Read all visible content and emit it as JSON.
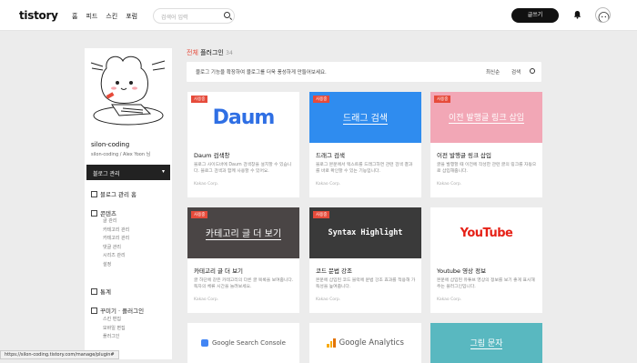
{
  "topbar": {
    "logo": "tistory",
    "nav": [
      "홈",
      "피드",
      "스킨",
      "포럼"
    ],
    "search_placeholder": "검색어 입력",
    "write_label": "글쓰기"
  },
  "sidebar": {
    "blog_name": "silon-coding",
    "blog_id": "silon-coding / Alex Yoon 님",
    "manage_label": "블로그 관리",
    "home_label": "블로그 관리 홈",
    "sections": [
      {
        "title": "콘텐츠",
        "items": [
          "글 관리",
          "카테고리 관리",
          "카테고리 관리",
          "댓글 관리",
          "시리즈 관리",
          "설정"
        ]
      },
      {
        "title": "통계"
      },
      {
        "title": "꾸미기 · 플러그인",
        "items": [
          "스킨 편집",
          "모바일 편집",
          "플러그인"
        ]
      }
    ]
  },
  "main": {
    "heading_accent": "전체",
    "heading_rest": " 플러그인",
    "count": "34",
    "bar_text": "블로그 기능을 확장하여 블로그를 더욱 풍성하게 만들어보세요.",
    "sort_label": "최신순",
    "find_label": "검색"
  },
  "cards": [
    {
      "badge": "사용중",
      "thumb": "Daum",
      "title": "Daum 검색창",
      "desc": "블로그 사이드바에 Daum 검색창을 설치할 수 있습니다. 블로그 검색과 함께 사용할 수 있어요.",
      "meta": "Kakao Corp."
    },
    {
      "badge": "사용중",
      "thumb": "드래그 검색",
      "title": "드래그 검색",
      "desc": "블로그 본문에서 텍스트를 드래그하면 관련 검색 결과를 바로 확인할 수 있는 기능입니다.",
      "meta": "Kakao Corp."
    },
    {
      "badge": "사용중",
      "thumb": "이전 발행글 링크 삽입",
      "title": "이전 발행글 링크 삽입",
      "desc": "글을 발행할 때 이전에 작성한 관련 글의 링크를 자동으로 삽입해줍니다.",
      "meta": "Kakao Corp."
    },
    {
      "badge": "사용중",
      "thumb": "카테고리 글 더 보기",
      "title": "카테고리 글 더 보기",
      "desc": "글 하단에 같은 카테고리의 다른 글 목록을 보여줍니다. 독자의 체류 시간을 늘려보세요.",
      "meta": "Kakao Corp."
    },
    {
      "badge": "사용중",
      "thumb": "Syntax Highlight",
      "title": "코드 문법 강조",
      "desc": "본문에 삽입된 코드 블럭에 문법 강조 효과를 적용해 가독성을 높여줍니다.",
      "meta": "Kakao Corp."
    },
    {
      "badge": "",
      "thumb": "YouTube",
      "title": "Youtube 영상 정보",
      "desc": "본문에 삽입된 유튜브 영상의 정보를 보기 좋게 표시해주는 플러그인입니다.",
      "meta": "Kakao Corp."
    }
  ],
  "bottom_cards": [
    "Google Search Console",
    "Google Analytics",
    "그림 문자"
  ],
  "status_url": "https://silon-coding.tistory.com/manage/plugin#"
}
